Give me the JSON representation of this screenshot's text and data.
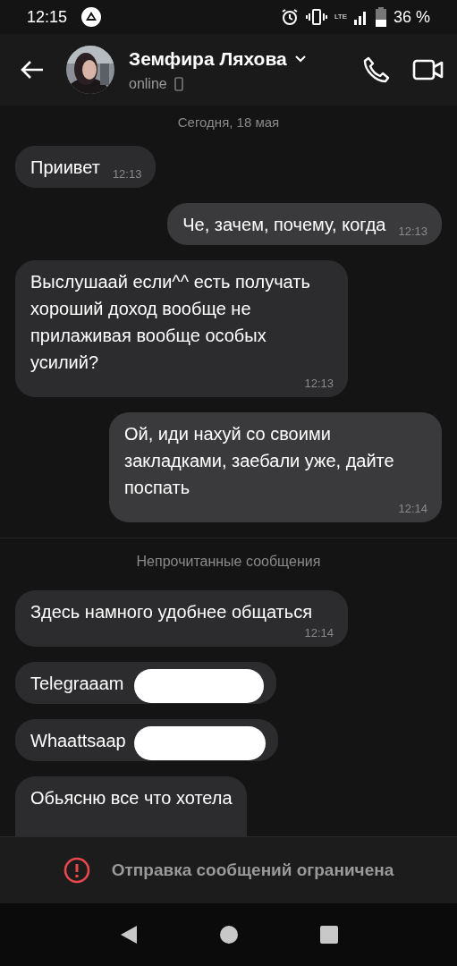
{
  "status_bar": {
    "time": "12:15",
    "network": "LTE",
    "battery": "36 %"
  },
  "header": {
    "name": "Земфира Ляхова",
    "presence": "online"
  },
  "messages": [
    {
      "kind": "date",
      "text": "Сегодня, 18 мая"
    },
    {
      "kind": "in",
      "text": "Приивет",
      "time": "12:13"
    },
    {
      "kind": "out",
      "text": "Че, зачем, почему, когда",
      "time": "12:13"
    },
    {
      "kind": "in",
      "text": "Выслушаай если^^ есть получать хороший доход вообще не прилаживая вообще особых усилий?",
      "time": "12:13"
    },
    {
      "kind": "out",
      "text": "Ой, иди нахуй со своими закладками, заебали уже, дайте поспать",
      "time": "12:14"
    },
    {
      "kind": "unread",
      "text": "Непрочитанные сообщения"
    },
    {
      "kind": "in",
      "text": "Здесь намного удобнее общаться",
      "time": "12:14"
    },
    {
      "kind": "in",
      "text": "Telegraaam",
      "redacted": true
    },
    {
      "kind": "in",
      "text": "Whaattsaap",
      "redacted": true
    },
    {
      "kind": "in",
      "text": "Обьясню все что хотела"
    }
  ],
  "notice": "Отправка сообщений ограничена"
}
